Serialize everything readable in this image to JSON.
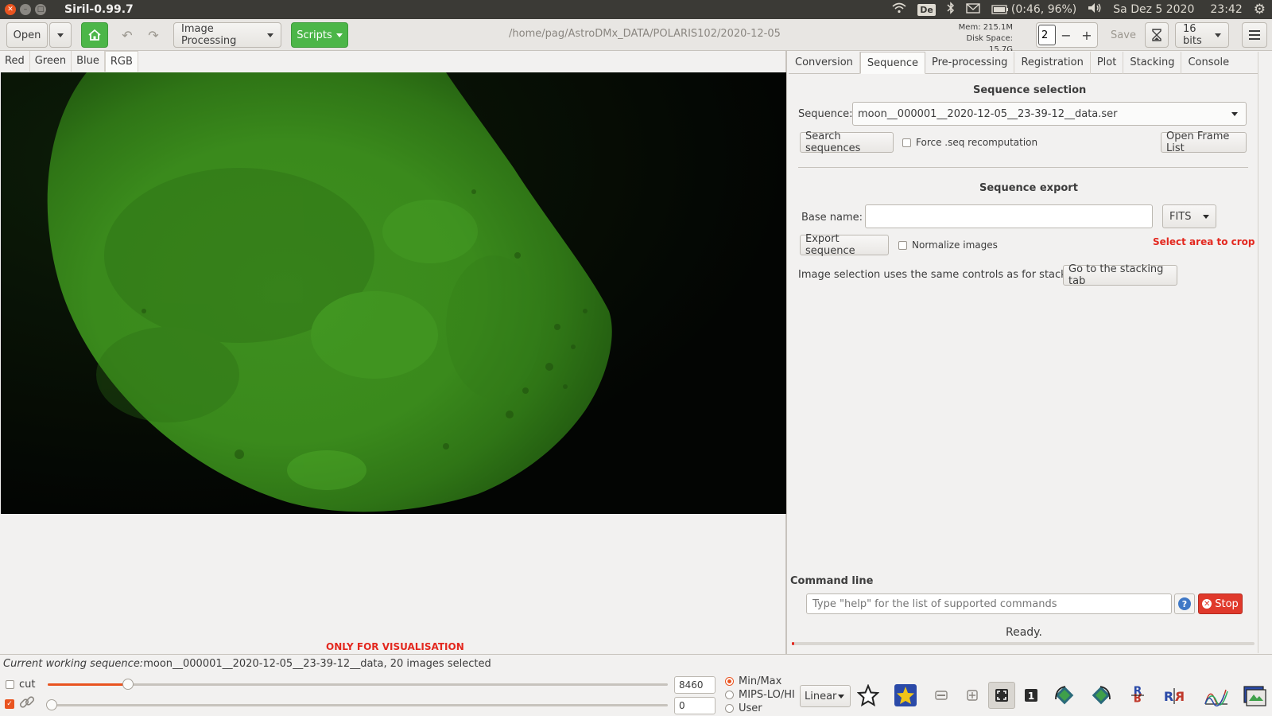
{
  "window": {
    "title": "Siril-0.99.7",
    "path": "/home/pag/AstroDMx_DATA/POLARIS102/2020-12-05"
  },
  "system_tray": {
    "keyboard_layout": "De",
    "battery": "(0:46, 96%)",
    "date": "Sa Dez  5 2020",
    "time": "23:42"
  },
  "toolbar": {
    "open_label": "Open",
    "image_processing_label": "Image Processing",
    "scripts_label": "Scripts",
    "mem": "Mem: 215.1M",
    "disk_space": "Disk Space: 15.7G",
    "threads_value": "2",
    "save_label": "Save",
    "bit_depth_label": "16 bits"
  },
  "channel_tabs": [
    "Red",
    "Green",
    "Blue",
    "RGB"
  ],
  "viewer": {
    "visualisation_note": "ONLY FOR VISUALISATION"
  },
  "right_tabs": [
    "Conversion",
    "Sequence",
    "Pre-processing",
    "Registration",
    "Plot",
    "Stacking",
    "Console"
  ],
  "sequence_selection": {
    "title": "Sequence selection",
    "sequence_label": "Sequence:",
    "sequence_value": "moon__000001__2020-12-05__23-39-12__data.ser",
    "search_button": "Search sequences",
    "force_recompute_label": "Force .seq recomputation",
    "open_frame_list_button": "Open Frame List"
  },
  "sequence_export": {
    "title": "Sequence export",
    "base_name_label": "Base name:",
    "base_name_value": "",
    "format_value": "FITS",
    "export_button": "Export sequence",
    "normalize_label": "Normalize images",
    "crop_warning": "Select area to crop",
    "selection_note": "Image selection uses the same controls as for stacking:",
    "stacking_tab_button": "Go to the stacking tab"
  },
  "command_line": {
    "title": "Command line",
    "placeholder": "Type \"help\" for the list of supported commands",
    "help_icon": "question-icon",
    "stop_label": "Stop",
    "status": "Ready.",
    "progress_fraction": 0.005
  },
  "bottom": {
    "current_sequence_prefix": "Current working sequence:",
    "current_sequence": "moon__000001__2020-12-05__23-39-12__data, 20 images selected",
    "cut_label": "cut",
    "high_value": "8460",
    "low_value": "0",
    "high_slider_fraction": 0.13,
    "low_slider_fraction": 0.0,
    "scaling_modes": [
      "Min/Max",
      "MIPS-LO/HI",
      "User"
    ],
    "selected_mode": "Min/Max",
    "display_mode": "Linear"
  },
  "colors": {
    "accent_orange": "#e95420",
    "scripts_green": "#4cb648",
    "warning_red": "#e3281f",
    "moon_green": "#3e8f1f"
  }
}
